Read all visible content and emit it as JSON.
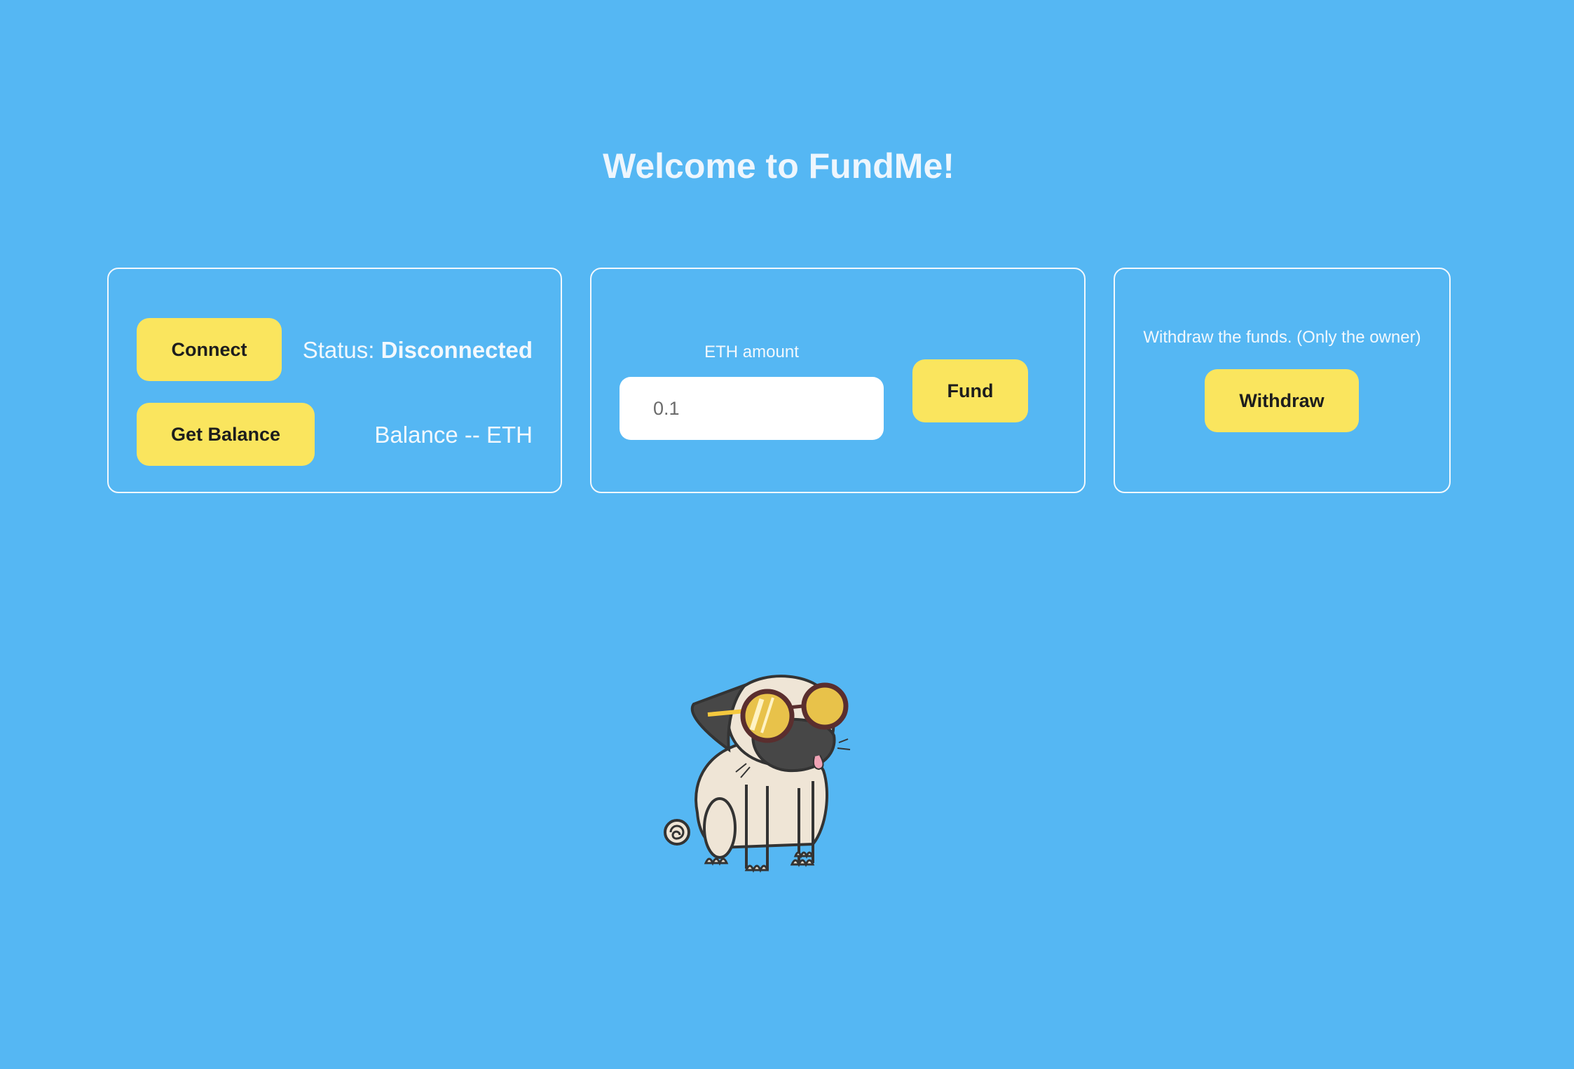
{
  "page": {
    "title": "Welcome to FundMe!"
  },
  "connection_card": {
    "connect_label": "Connect",
    "status_prefix": "Status:",
    "status_value": "Disconnected",
    "get_balance_label": "Get Balance",
    "balance_text": "Balance -- ETH"
  },
  "fund_card": {
    "amount_label": "ETH amount",
    "amount_placeholder": "0.1",
    "fund_label": "Fund"
  },
  "withdraw_card": {
    "description": "Withdraw the funds. (Only the owner)",
    "withdraw_label": "Withdraw"
  },
  "illustration": {
    "icon": "pug-with-sunglasses"
  },
  "colors": {
    "background": "#55b7f3",
    "button": "#fae55e",
    "text": "#f2f8fd"
  }
}
